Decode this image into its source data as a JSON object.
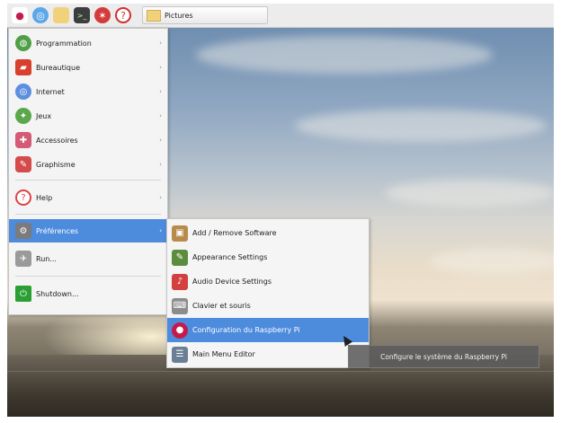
{
  "taskbar": {
    "task_label": "Pictures"
  },
  "menu": {
    "items": [
      {
        "label": "Programmation",
        "icon": "programming-icon",
        "color": "#4f9f45"
      },
      {
        "label": "Bureautique",
        "icon": "office-icon",
        "color": "#d83f2f"
      },
      {
        "label": "Internet",
        "icon": "internet-icon",
        "color": "#5d8fe0"
      },
      {
        "label": "Jeux",
        "icon": "games-icon",
        "color": "#5ba74b"
      },
      {
        "label": "Accessoires",
        "icon": "accessories-icon",
        "color": "#d45a75"
      },
      {
        "label": "Graphisme",
        "icon": "graphics-icon",
        "color": "#d54b4b"
      },
      {
        "label": "Help",
        "icon": "help-icon",
        "color": "#d94545"
      },
      {
        "label": "Préférences",
        "icon": "preferences-icon",
        "color": "#7b7b7b"
      },
      {
        "label": "Run...",
        "icon": "run-icon",
        "color": "#9a9a9a"
      },
      {
        "label": "Shutdown...",
        "icon": "shutdown-icon",
        "color": "#2b9f33"
      }
    ]
  },
  "submenu": {
    "items": [
      {
        "label": "Add / Remove Software",
        "icon": "package-icon",
        "color": "#b88b4a"
      },
      {
        "label": "Appearance Settings",
        "icon": "appearance-icon",
        "color": "#5c8d3e"
      },
      {
        "label": "Audio Device Settings",
        "icon": "audio-icon",
        "color": "#d43f3f"
      },
      {
        "label": "Clavier et souris",
        "icon": "keyboard-mouse-icon",
        "color": "#8c8c8c"
      },
      {
        "label": "Configuration du Raspberry Pi",
        "icon": "raspberry-pi-icon",
        "color": "#c51a4a"
      },
      {
        "label": "Main Menu Editor",
        "icon": "menu-editor-icon",
        "color": "#6a7f95"
      }
    ]
  },
  "tooltip": {
    "text": "Configure le système du Raspberry Pi"
  }
}
